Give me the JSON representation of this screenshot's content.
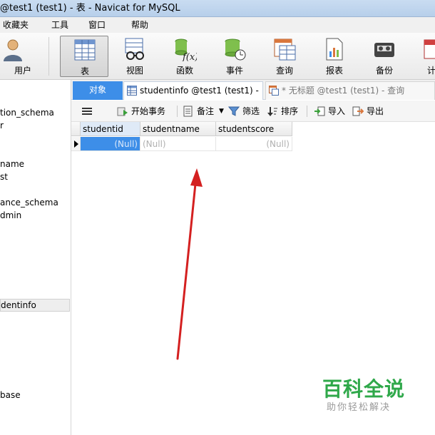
{
  "window": {
    "title": "@test1 (test1) - 表 - Navicat for MySQL"
  },
  "menu": {
    "items": [
      "收藏夹",
      "工具",
      "窗口",
      "帮助"
    ]
  },
  "toolbar": {
    "items": [
      {
        "label": "用户",
        "icon": "user-icon"
      },
      {
        "label": "表",
        "icon": "table-icon",
        "active": true
      },
      {
        "label": "视图",
        "icon": "view-icon"
      },
      {
        "label": "函数",
        "icon": "function-icon"
      },
      {
        "label": "事件",
        "icon": "event-icon"
      },
      {
        "label": "查询",
        "icon": "query-icon"
      },
      {
        "label": "报表",
        "icon": "report-icon"
      },
      {
        "label": "备份",
        "icon": "backup-icon"
      },
      {
        "label": "计",
        "icon": "schedule-icon"
      }
    ]
  },
  "sidebar": {
    "items": [
      "tion_schema",
      "r",
      "name",
      "st",
      "ance_schema",
      "dmin",
      "dentinfo",
      "base"
    ]
  },
  "tabs": {
    "objects": "对象",
    "tab1": "studentinfo @test1 (test1) - ...",
    "tab2": "* 无标题 @test1 (test1) - 查询"
  },
  "actions": {
    "begin_transaction": "开始事务",
    "memo": "备注",
    "filter": "筛选",
    "sort": "排序",
    "import": "导入",
    "export": "导出"
  },
  "grid": {
    "columns": [
      "studentid",
      "studentname",
      "studentscore"
    ],
    "rows": [
      [
        "(Null)",
        "(Null)",
        "(Null)"
      ]
    ]
  },
  "watermark": {
    "title": "百科全说",
    "subtitle": "助你轻松解决"
  },
  "colors": {
    "accent": "#3d8ee8",
    "arrow": "#d42020",
    "watermark": "#2fa84a"
  }
}
